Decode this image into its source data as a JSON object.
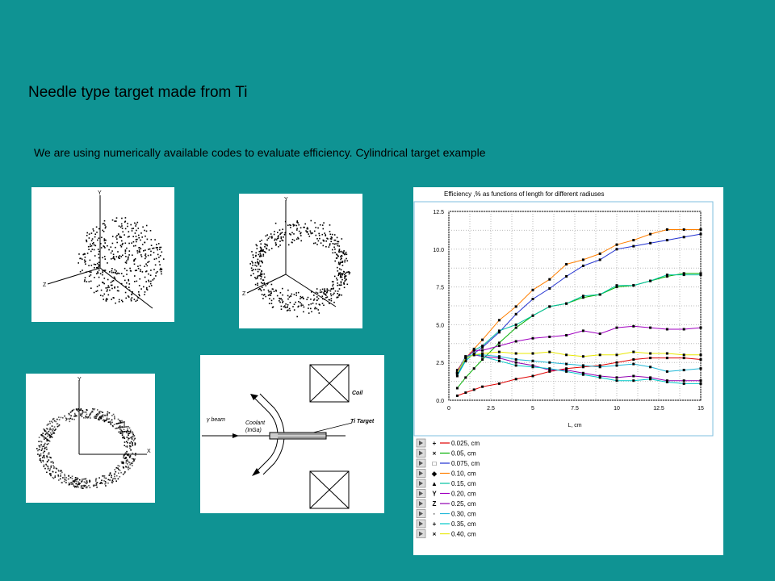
{
  "slide": {
    "title": "Needle type target made from Ti",
    "subtitle": "We are using numerically available codes to evaluate efficiency. Cylindrical target example"
  },
  "diagram": {
    "coil_label": "Coil",
    "beam_label": "γ  beam",
    "coolant_label": "Coolant",
    "coolant_sub": "(InGa)",
    "target_label": "Ti Target"
  },
  "axis_letters": {
    "x": "X",
    "y": "Y",
    "z": "Z"
  },
  "chart_data": {
    "type": "line",
    "title": "Efficiency ,% as functions of length for different radiuses",
    "xlabel": "L, cm",
    "ylabel": "",
    "xlim": [
      0,
      15
    ],
    "ylim": [
      0,
      12.5
    ],
    "xticks": [
      0,
      2.5,
      5,
      7.5,
      10,
      12.5,
      15
    ],
    "yticks": [
      0.0,
      2.5,
      5.0,
      7.5,
      10.0,
      12.5
    ],
    "ytick_labels": [
      "0.0",
      "2.5",
      "5.0",
      "7.5",
      "10.0",
      "12.5"
    ],
    "xtick_labels": [
      "0",
      "2.5",
      "5",
      "7.5",
      "10",
      "12.5",
      "15"
    ],
    "grid": true,
    "legend_position": "bottom",
    "x": [
      0.5,
      1.0,
      1.5,
      2.0,
      3.0,
      4.0,
      5.0,
      6.0,
      7.0,
      8.0,
      9.0,
      10.0,
      11.0,
      12.0,
      13.0,
      14.0,
      15.0
    ],
    "series": [
      {
        "name": "0.025, cm",
        "marker": "+",
        "color": "#e00000",
        "values": [
          0.3,
          0.5,
          0.7,
          0.9,
          1.1,
          1.4,
          1.6,
          1.9,
          2.1,
          2.2,
          2.3,
          2.5,
          2.7,
          2.8,
          2.8,
          2.8,
          2.7
        ]
      },
      {
        "name": "0.05, cm",
        "marker": "×",
        "color": "#00b000",
        "values": [
          0.8,
          1.5,
          2.1,
          2.7,
          3.8,
          4.8,
          5.6,
          6.2,
          6.4,
          6.8,
          7.0,
          7.5,
          7.6,
          7.9,
          8.2,
          8.4,
          8.4
        ]
      },
      {
        "name": "0.075, cm",
        "marker": "□",
        "color": "#2030d0",
        "values": [
          1.7,
          2.6,
          3.1,
          3.5,
          4.5,
          5.7,
          6.7,
          7.4,
          8.2,
          8.9,
          9.3,
          10.0,
          10.2,
          10.4,
          10.6,
          10.8,
          11.0
        ]
      },
      {
        "name": "0.10, cm",
        "marker": "◆",
        "color": "#ff7f00",
        "values": [
          2.0,
          2.8,
          3.4,
          4.0,
          5.3,
          6.2,
          7.3,
          8.0,
          9.0,
          9.3,
          9.7,
          10.3,
          10.6,
          11.0,
          11.3,
          11.3,
          11.3
        ]
      },
      {
        "name": "0.15, cm",
        "marker": "▲",
        "color": "#00c0a0",
        "values": [
          1.8,
          2.7,
          3.3,
          3.6,
          4.6,
          5.0,
          5.6,
          6.2,
          6.4,
          6.9,
          7.0,
          7.6,
          7.6,
          7.9,
          8.3,
          8.3,
          8.3
        ]
      },
      {
        "name": "0.20, cm",
        "marker": "Y",
        "color": "#a000c0",
        "values": [
          1.8,
          2.8,
          3.3,
          3.3,
          3.6,
          3.9,
          4.1,
          4.2,
          4.3,
          4.6,
          4.4,
          4.8,
          4.9,
          4.8,
          4.7,
          4.7,
          4.8
        ]
      },
      {
        "name": "0.25, cm",
        "marker": "Z",
        "color": "#9000b0",
        "values": [
          1.9,
          2.9,
          3.0,
          2.9,
          2.8,
          2.5,
          2.3,
          2.0,
          2.0,
          1.8,
          1.6,
          1.5,
          1.6,
          1.5,
          1.3,
          1.3,
          1.3
        ]
      },
      {
        "name": "0.30, cm",
        "marker": "·",
        "color": "#20b8d8",
        "values": [
          1.8,
          2.9,
          3.0,
          3.0,
          2.9,
          2.7,
          2.6,
          2.5,
          2.4,
          2.3,
          2.2,
          2.3,
          2.4,
          2.2,
          1.9,
          2.0,
          2.1
        ]
      },
      {
        "name": "0.35, cm",
        "marker": "+",
        "color": "#00c8c8",
        "values": [
          1.6,
          2.6,
          3.1,
          2.9,
          2.6,
          2.3,
          2.2,
          2.1,
          1.9,
          1.7,
          1.5,
          1.3,
          1.3,
          1.4,
          1.2,
          1.1,
          1.1
        ]
      },
      {
        "name": "0.40, cm",
        "marker": "×",
        "color": "#e8e800",
        "values": [
          1.8,
          2.8,
          3.0,
          3.1,
          3.2,
          3.1,
          3.1,
          3.2,
          3.0,
          2.9,
          3.0,
          3.0,
          3.2,
          3.1,
          3.1,
          3.0,
          3.0
        ]
      }
    ]
  }
}
